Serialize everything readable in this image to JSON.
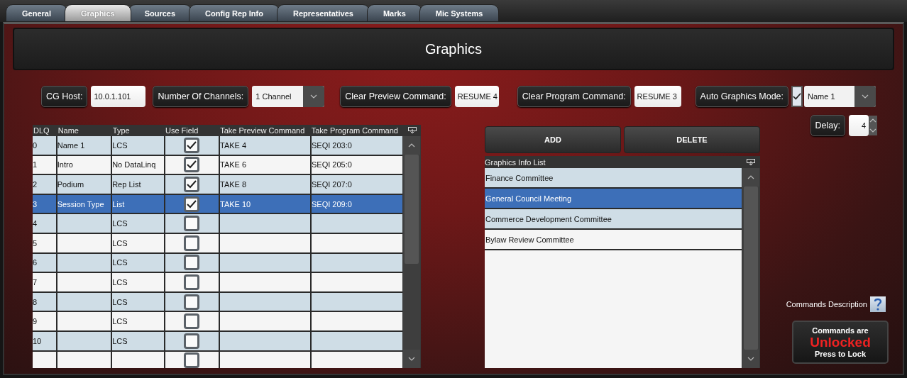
{
  "tabs": [
    {
      "label": "General",
      "selected": false
    },
    {
      "label": "Graphics",
      "selected": true
    },
    {
      "label": "Sources",
      "selected": false
    },
    {
      "label": "Config Rep Info",
      "selected": false
    },
    {
      "label": "Representatives",
      "selected": false
    },
    {
      "label": "Marks",
      "selected": false
    },
    {
      "label": "Mic Systems",
      "selected": false
    }
  ],
  "title": "Graphics",
  "settings": {
    "cg_host": {
      "label": "CG Host:",
      "value": "10.0.1.101"
    },
    "channels": {
      "label": "Number Of Channels:",
      "value": "1 Channel"
    },
    "clear_preview": {
      "label": "Clear Preview Command:",
      "value": "RESUME 4"
    },
    "clear_program": {
      "label": "Clear Program Command:",
      "value": "RESUME 3"
    },
    "auto_graphics": {
      "label": "Auto Graphics Mode:",
      "checked": true,
      "value": "Name 1"
    },
    "delay": {
      "label": "Delay:",
      "value": "4"
    }
  },
  "table": {
    "columns": [
      "DLQ",
      "Name",
      "Type",
      "Use Field",
      "Take Preview Command",
      "Take Program Command"
    ],
    "rows": [
      {
        "dlq": "0",
        "name": "Name 1",
        "type": "LCS",
        "use_field": true,
        "preview": "TAKE 4",
        "program": "SEQI 203:0",
        "selected": false
      },
      {
        "dlq": "1",
        "name": "Intro",
        "type": "No DataLinq",
        "use_field": true,
        "preview": "TAKE 6",
        "program": "SEQI 205:0",
        "selected": false
      },
      {
        "dlq": "2",
        "name": "Podium",
        "type": "Rep List",
        "use_field": true,
        "preview": "TAKE 8",
        "program": "SEQI 207:0",
        "selected": false
      },
      {
        "dlq": "3",
        "name": "Session Type",
        "type": "List",
        "use_field": true,
        "preview": "TAKE 10",
        "program": "SEQI 209:0",
        "selected": true
      },
      {
        "dlq": "4",
        "type": "LCS",
        "use_field": false,
        "selected": false
      },
      {
        "dlq": "5",
        "type": "LCS",
        "use_field": false,
        "selected": false
      },
      {
        "dlq": "6",
        "type": "LCS",
        "use_field": false,
        "selected": false
      },
      {
        "dlq": "7",
        "type": "LCS",
        "use_field": false,
        "selected": false
      },
      {
        "dlq": "8",
        "type": "LCS",
        "use_field": false,
        "selected": false
      },
      {
        "dlq": "9",
        "type": "LCS",
        "use_field": false,
        "selected": false
      },
      {
        "dlq": "10",
        "type": "LCS",
        "use_field": false,
        "selected": false
      },
      {
        "use_field": false,
        "selected": false
      }
    ]
  },
  "info_list": {
    "buttons": [
      "ADD",
      "DELETE"
    ],
    "title": "Graphics Info List",
    "items": [
      {
        "label": "Finance Committee",
        "selected": false
      },
      {
        "label": "General Council Meeting",
        "selected": true
      },
      {
        "label": "Commerce Development Committee",
        "selected": false
      },
      {
        "label": "Bylaw Review Committee",
        "selected": false
      }
    ]
  },
  "commands_description": "Commands Description",
  "lock": {
    "heading": "Commands are",
    "status": "Unlocked",
    "action": "Press to Lock"
  }
}
